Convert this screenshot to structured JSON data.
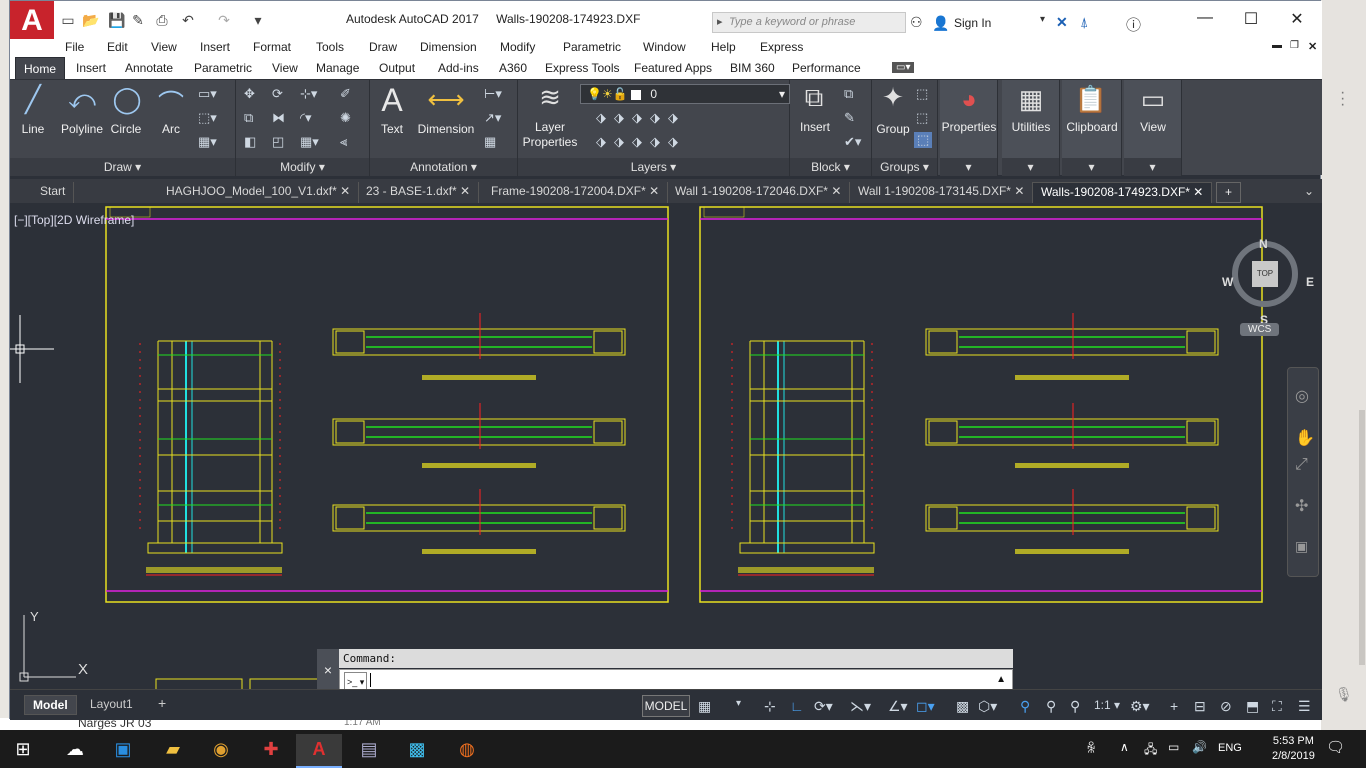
{
  "window": {
    "title": "Autodesk AutoCAD 2017",
    "filename": "Walls-190208-174923.DXF",
    "logo_letter": "A",
    "search_placeholder": "Type a keyword or phrase",
    "sign_in": "Sign In"
  },
  "menus": [
    "File",
    "Edit",
    "View",
    "Insert",
    "Format",
    "Tools",
    "Draw",
    "Dimension",
    "Modify",
    "Parametric",
    "Window",
    "Help",
    "Express"
  ],
  "ribbon_tabs": [
    "Home",
    "Insert",
    "Annotate",
    "Parametric",
    "View",
    "Manage",
    "Output",
    "Add-ins",
    "A360",
    "Express Tools",
    "Featured Apps",
    "BIM 360",
    "Performance"
  ],
  "ribbon": {
    "draw": {
      "title": "Draw",
      "line": "Line",
      "polyline": "Polyline",
      "circle": "Circle",
      "arc": "Arc"
    },
    "modify": {
      "title": "Modify"
    },
    "annotation": {
      "title": "Annotation",
      "text": "Text",
      "dimension": "Dimension"
    },
    "layers": {
      "title": "Layers",
      "layer_properties": "Layer Properties",
      "current_layer": "0"
    },
    "block": {
      "title": "Block",
      "insert": "Insert"
    },
    "groups": {
      "title": "Groups",
      "group": "Group"
    },
    "properties": "Properties",
    "utilities": "Utilities",
    "clipboard": "Clipboard",
    "view": "View"
  },
  "doc_tabs": [
    "Start",
    "HAGHJOO_Model_100_V1.dxf*",
    "23 - BASE-1.dxf*",
    "Frame-190208-172004.DXF*",
    "Wall 1-190208-172046.DXF*",
    "Wall 1-190208-173145.DXF*",
    "Walls-190208-174923.DXF*"
  ],
  "viewport": {
    "label": "[−][Top][2D Wireframe]",
    "viewcube": {
      "n": "N",
      "s": "S",
      "e": "E",
      "w": "W",
      "top": "TOP",
      "wcs": "WCS"
    },
    "ucs": {
      "x": "X",
      "y": "Y"
    }
  },
  "command": {
    "title": "Command:",
    "close": "×"
  },
  "status": {
    "model_tab": "Model",
    "layout_tab": "Layout1",
    "add": "+",
    "model_btn": "MODEL",
    "scale": "1:1"
  },
  "taskbar": {
    "time": "5:53 PM",
    "date": "2/8/2019",
    "lang": "ENG"
  },
  "background": {
    "under_text": "Narges JR 03",
    "under_time": "1:17 AM"
  },
  "colors": {
    "autocad_red": "#c8232c",
    "drawing_bg": "#2c3038",
    "ribbon_bg": "#43464d",
    "frame_yellow": "#e8e020",
    "magenta": "#e020e0",
    "rebar_green": "#20e020",
    "cyan": "#20e0e0",
    "red": "#ff2020"
  }
}
